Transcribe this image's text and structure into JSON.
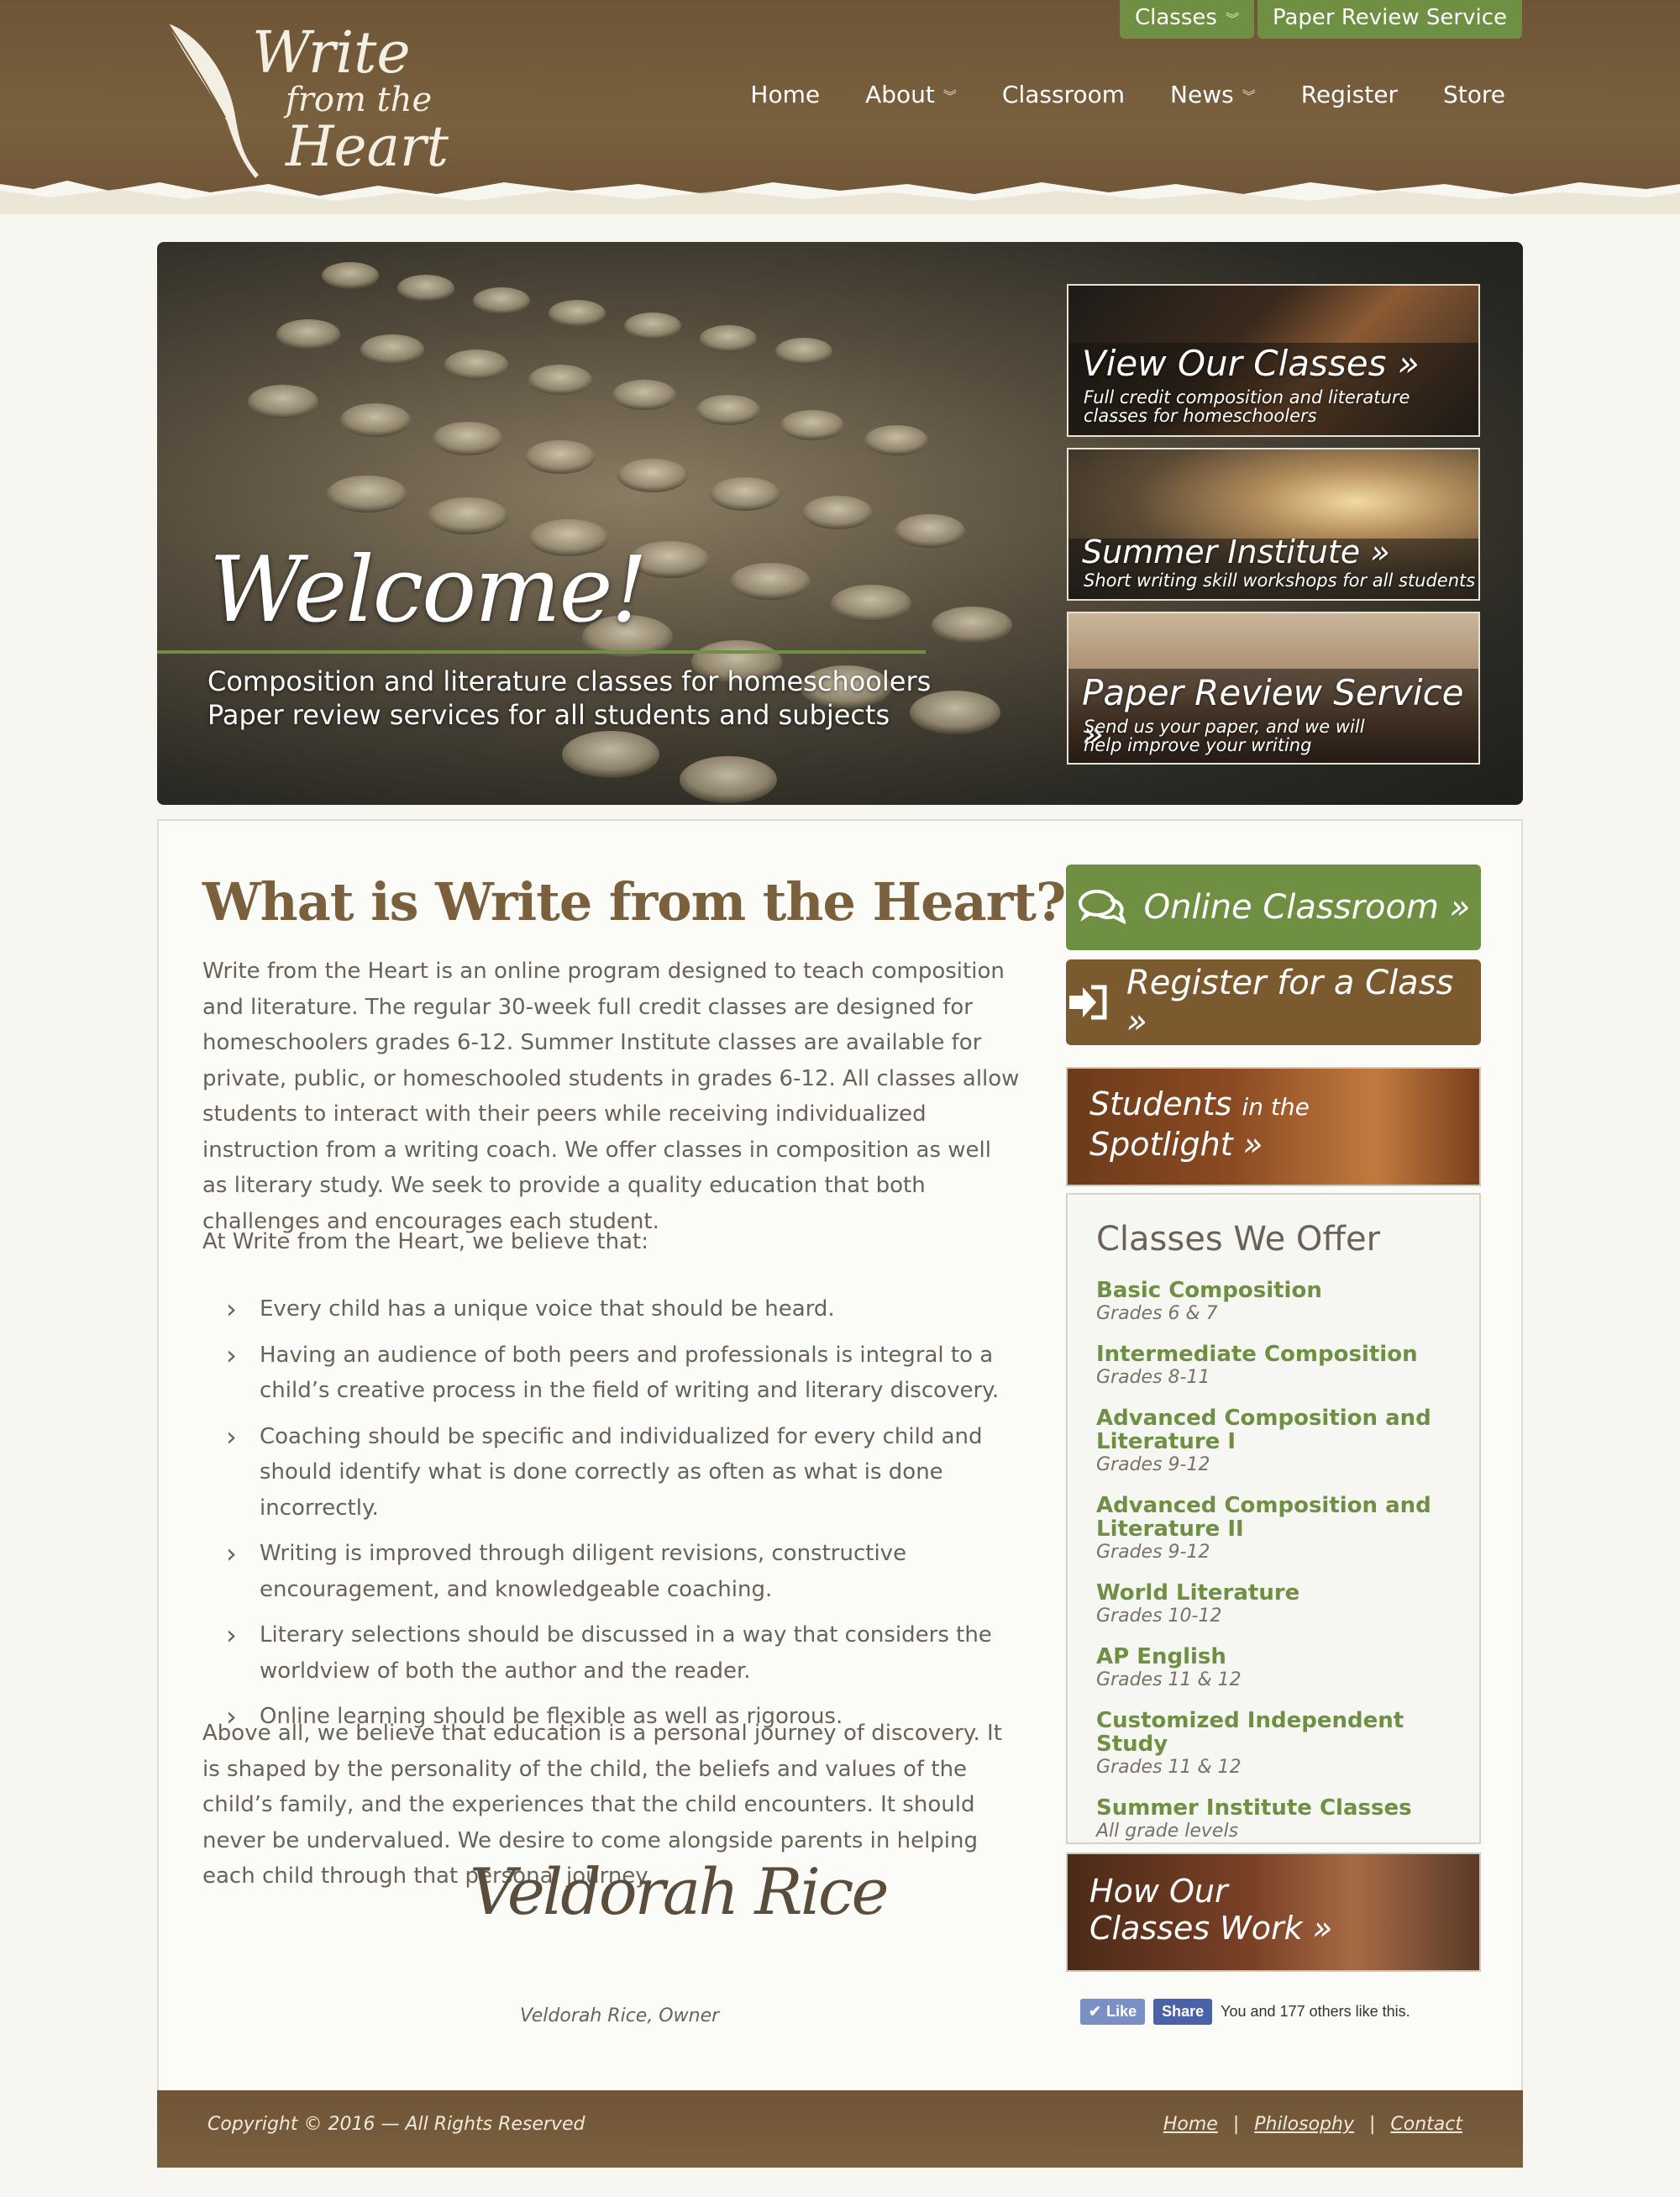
{
  "utility_nav": {
    "classes_label": "Classes",
    "paper_review_label": "Paper Review Service"
  },
  "logo": {
    "line1": "Write",
    "line2": "from the",
    "line3": "Heart"
  },
  "main_nav": [
    {
      "label": "Home",
      "has_dropdown": false
    },
    {
      "label": "About",
      "has_dropdown": true
    },
    {
      "label": "Classroom",
      "has_dropdown": false
    },
    {
      "label": "News",
      "has_dropdown": true
    },
    {
      "label": "Register",
      "has_dropdown": false
    },
    {
      "label": "Store",
      "has_dropdown": false
    }
  ],
  "hero": {
    "welcome": "Welcome!",
    "sub_line1": "Composition and literature classes for homeschoolers",
    "sub_line2": "Paper review services for all students and subjects",
    "promos": [
      {
        "title": "View Our Classes »",
        "desc1": "Full credit composition and literature",
        "desc2": "classes for homeschoolers"
      },
      {
        "title": "Summer Institute »",
        "desc1": "Short writing skill workshops for all students",
        "desc2": ""
      },
      {
        "title": "Paper Review Service »",
        "desc1": "Send us your paper, and we will",
        "desc2": "help improve your writing"
      }
    ]
  },
  "content": {
    "heading": "What is Write from the Heart?",
    "intro": "Write from the Heart is an online program designed to teach composition and literature. The regular 30-week full credit classes are designed for homeschoolers grades 6-12. Summer Institute classes are available for private, public, or homeschooled students in grades 6-12. All classes allow students to interact with their peers while receiving individualized instruction from a writing coach. We offer classes in composition as well as literary study. We seek to provide a quality education that both challenges and encourages each student.",
    "belief_intro": "At Write from the Heart, we believe that:",
    "beliefs": [
      "Every child has a unique voice that should be heard.",
      "Having an audience of both peers and professionals is integral to a child’s creative process in the field of writing and literary discovery.",
      "Coaching should be specific and individualized for every child and should identify what is done correctly as often as what is done incorrectly.",
      "Writing is improved through diligent revisions, constructive encouragement, and knowledgeable coaching.",
      "Literary selections should be discussed in a way that considers the worldview of both the author and the reader.",
      "Online learning should be flexible as well as rigorous."
    ],
    "closing": "Above all, we believe that education is a personal journey of discovery. It is shaped by the personality of the child, the beliefs and values of the child’s family, and the experiences that the child encounters. It should never be undervalued. We desire to come alongside parents in helping each child through that personal journey.",
    "signature": "Veldorah Rice",
    "signature_caption": "Veldorah Rice, Owner"
  },
  "sidebar": {
    "online_classroom": "Online Classroom »",
    "register": "Register for a Class »",
    "spotlight_line1": "Students",
    "spotlight_small": "in the",
    "spotlight_line2": "Spotlight »",
    "classes_title": "Classes We Offer",
    "classes": [
      {
        "name": "Basic Composition",
        "grades": "Grades 6 & 7"
      },
      {
        "name": "Intermediate Composition",
        "grades": "Grades 8-11"
      },
      {
        "name": "Advanced Composition and Literature I",
        "grades": "Grades 9-12"
      },
      {
        "name": "Advanced Composition and Literature II",
        "grades": "Grades 9-12"
      },
      {
        "name": "World Literature",
        "grades": "Grades 10-12"
      },
      {
        "name": "AP English",
        "grades": "Grades 11 & 12"
      },
      {
        "name": "Customized Independent Study",
        "grades": "Grades 11 & 12"
      },
      {
        "name": "Summer Institute Classes",
        "grades": "All grade levels"
      }
    ],
    "how_line1": "How Our",
    "how_line2": "Classes Work »",
    "fb_like": "Like",
    "fb_share": "Share",
    "fb_text": "You and 177 others like this."
  },
  "footer": {
    "copyright": "Copyright © 2016 — All Rights Reserved",
    "links": [
      "Home",
      "Philosophy",
      "Contact"
    ],
    "separator": "|"
  },
  "colors": {
    "header_brown": "#75593a",
    "accent_green": "#6f8f43",
    "button_brown": "#7b5a2f",
    "heading_brown": "#7a603d",
    "page_bg": "#f7f6f1"
  }
}
